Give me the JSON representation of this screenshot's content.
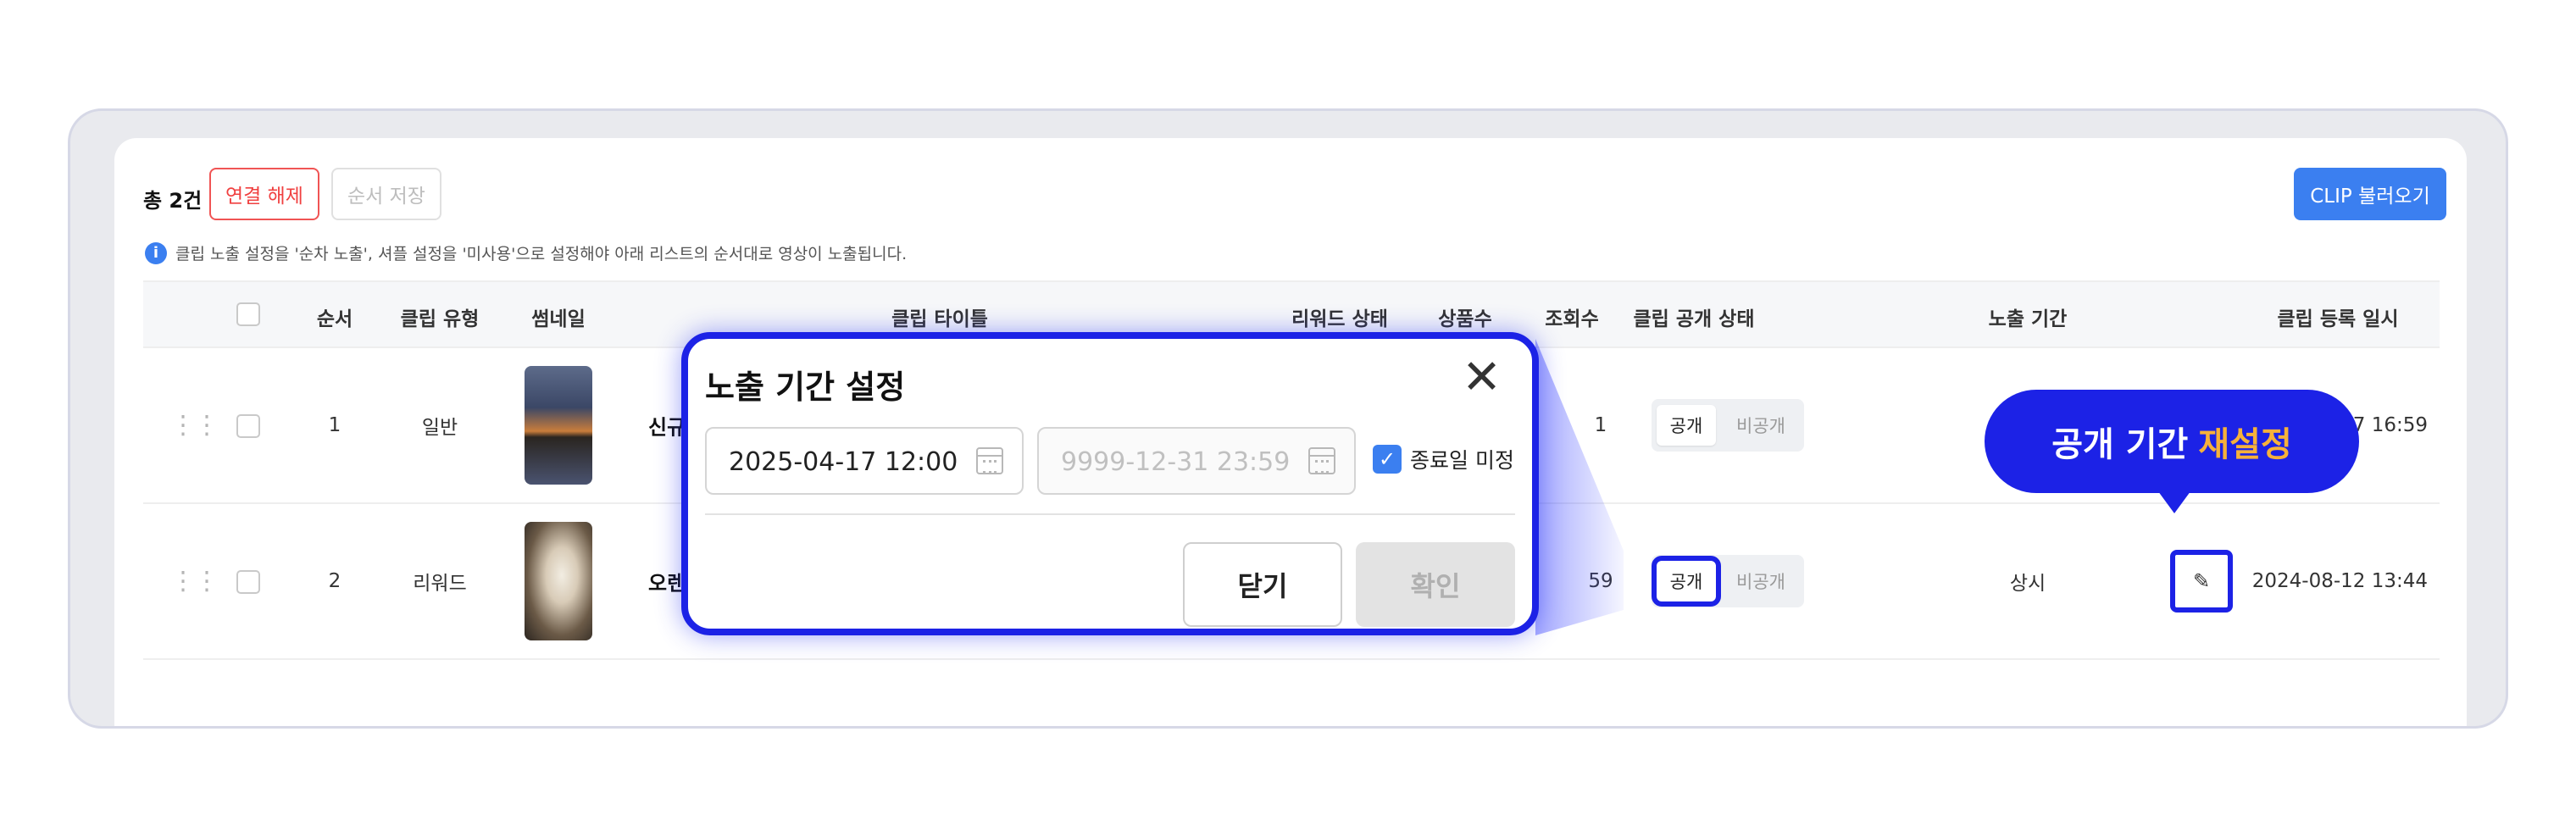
{
  "toolbar": {
    "total": "총 2건",
    "unlink_label": "연결 해제",
    "save_order_label": "순서 저장",
    "clip_load_label": "CLIP 불러오기"
  },
  "notice": {
    "icon": "info-icon",
    "text": "클립 노출 설정을 '순차 노출', 셔플 설정을 '미사용'으로 설정해야 아래 리스트의 순서대로 영상이 노출됩니다."
  },
  "table": {
    "headers": {
      "order": "순서",
      "clip_type": "클립 유형",
      "thumbnail": "썸네일",
      "clip_title": "클립 타이틀",
      "reward_status": "리워드 상태",
      "product_count": "상품수",
      "views": "조회수",
      "public_status": "클립 공개 상태",
      "exposure_period": "노출 기간",
      "registered_at": "클립 등록 일시"
    },
    "rows": [
      {
        "order": "1",
        "clip_type": "일반",
        "title": "신규",
        "views": "1",
        "public_on": "공개",
        "public_off": "비공개",
        "exposure_period": "",
        "registered_at": "17 16:59"
      },
      {
        "order": "2",
        "clip_type": "리워드",
        "title": "오렌",
        "views": "59",
        "public_on": "공개",
        "public_off": "비공개",
        "exposure_period": "상시",
        "registered_at": "2024-08-12 13:44"
      }
    ]
  },
  "popup": {
    "title": "노출 기간 설정",
    "start_date": "2025-04-17 12:00",
    "end_date": "9999-12-31 23:59",
    "no_end_label": "종료일 미정",
    "no_end_checked": true,
    "close_label": "닫기",
    "confirm_label": "확인"
  },
  "callout": {
    "text_main": "공개 기간",
    "text_accent": "재설정"
  },
  "colors": {
    "highlight": "#1c22e6",
    "accent_blue": "#3b7ff0",
    "danger": "#f04040",
    "callout_accent": "#f6b13a"
  }
}
